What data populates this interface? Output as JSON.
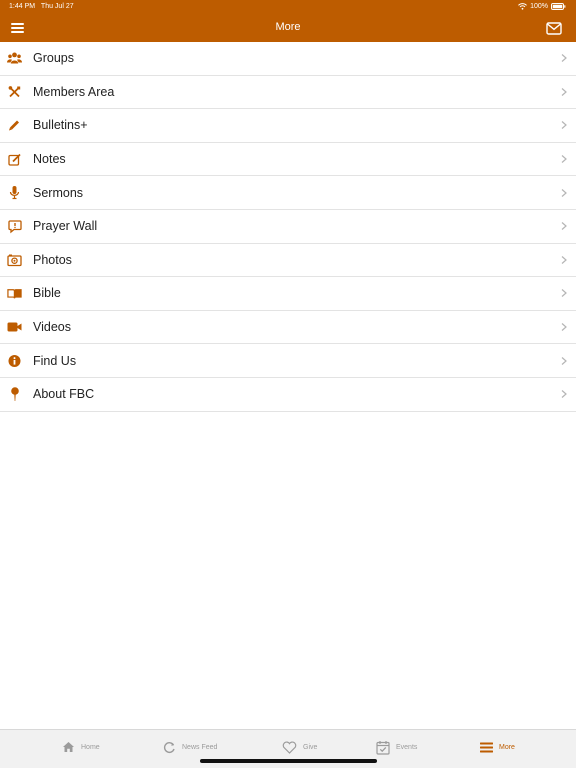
{
  "status": {
    "time": "1:44 PM",
    "date": "Thu Jul 27",
    "battery": "100%"
  },
  "header": {
    "title": "More",
    "menu_icon": "hamburger-icon",
    "mail_icon": "mail-icon"
  },
  "colors": {
    "accent": "#BD5C00",
    "tab_inactive": "#9b9b9b"
  },
  "menu": {
    "items": [
      {
        "label": "Groups",
        "icon": "groups-icon"
      },
      {
        "label": "Members Area",
        "icon": "tools-icon"
      },
      {
        "label": "Bulletins+",
        "icon": "pencil-icon"
      },
      {
        "label": "Notes",
        "icon": "edit-icon"
      },
      {
        "label": "Sermons",
        "icon": "microphone-icon"
      },
      {
        "label": "Prayer Wall",
        "icon": "prayer-bubble-icon"
      },
      {
        "label": "Photos",
        "icon": "camera-icon"
      },
      {
        "label": "Bible",
        "icon": "open-book-icon"
      },
      {
        "label": "Videos",
        "icon": "video-camera-icon"
      },
      {
        "label": "Find Us",
        "icon": "info-icon"
      },
      {
        "label": "About FBC",
        "icon": "pin-icon"
      }
    ]
  },
  "tabs": [
    {
      "label": "Home",
      "icon": "home-icon"
    },
    {
      "label": "News Feed",
      "icon": "refresh-icon"
    },
    {
      "label": "Give",
      "icon": "heart-icon"
    },
    {
      "label": "Events",
      "icon": "calendar-icon"
    },
    {
      "label": "More",
      "icon": "hamburger-icon",
      "active": true
    }
  ]
}
